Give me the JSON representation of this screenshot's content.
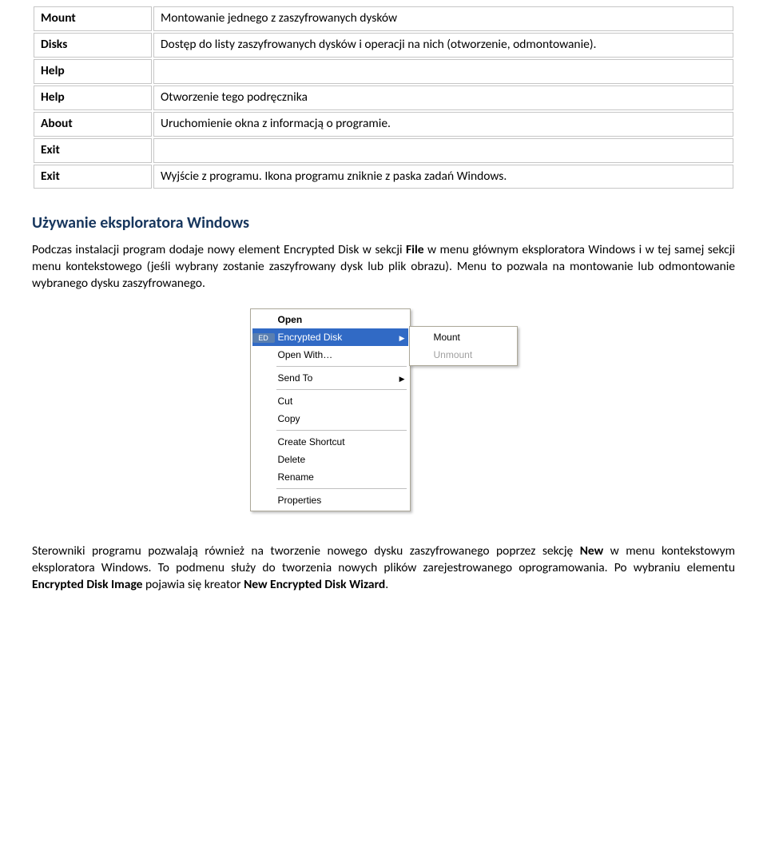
{
  "table": {
    "rows": [
      {
        "label": "Mount",
        "desc": "Montowanie jednego z zaszyfrowanych dysków"
      },
      {
        "label": "Disks",
        "desc": "Dostęp do listy zaszyfrowanych dysków i operacji na nich (otworzenie, odmontowanie)."
      },
      {
        "label": "Help",
        "desc": ""
      },
      {
        "label": "Help",
        "desc": "Otworzenie tego podręcznika"
      },
      {
        "label": "About",
        "desc": "Uruchomienie okna z informacją o programie."
      },
      {
        "label": "Exit",
        "desc": ""
      },
      {
        "label": "Exit",
        "desc": "Wyjście z programu. Ikona programu zniknie z paska zadań Windows."
      }
    ]
  },
  "section_heading": "Używanie eksploratora Windows",
  "para1_pre": "Podczas instalacji program dodaje nowy element Encrypted Disk w sekcji ",
  "para1_bold1": "File",
  "para1_post": " w menu głównym eksploratora Windows i w tej samej sekcji menu kontekstowego (jeśli wybrany zostanie zaszyfrowany dysk lub plik obrazu). Menu to pozwala na montowanie lub odmontowanie wybranego dysku zaszyfrowanego.",
  "context_menu": {
    "items": {
      "open": "Open",
      "encrypted_disk": "Encrypted Disk",
      "open_with": "Open With…",
      "send_to": "Send To",
      "cut": "Cut",
      "copy": "Copy",
      "create_shortcut": "Create Shortcut",
      "delete": "Delete",
      "rename": "Rename",
      "properties": "Properties"
    },
    "submenu": {
      "mount": "Mount",
      "unmount": "Unmount"
    },
    "ed_icon_text": "ED"
  },
  "para2_pre": "Sterowniki programu pozwalają również na tworzenie nowego dysku zaszyfrowanego poprzez sekcję ",
  "para2_bold1": "New",
  "para2_mid": " w menu kontekstowym eksploratora Windows. To podmenu służy do tworzenia nowych plików zarejestrowanego oprogramowania. Po wybraniu elementu ",
  "para2_bold2": "Encrypted Disk Image",
  "para2_mid2": " pojawia się kreator ",
  "para2_bold3": "New Encrypted Disk Wizard",
  "para2_end": "."
}
